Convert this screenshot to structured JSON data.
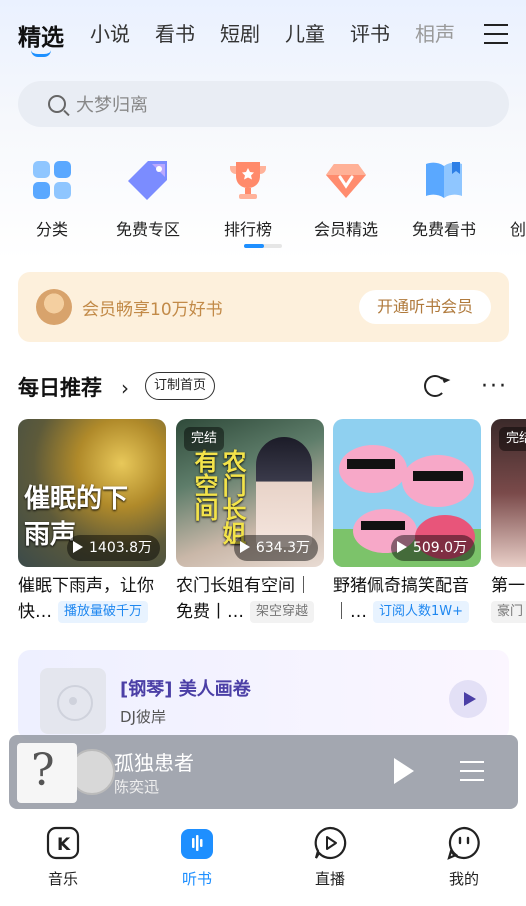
{
  "top_tabs": [
    "精选",
    "小说",
    "看书",
    "短剧",
    "儿童",
    "评书",
    "相声"
  ],
  "search": {
    "placeholder": "大梦归离"
  },
  "categories": [
    {
      "label": "分类",
      "icon": "category-grid-icon"
    },
    {
      "label": "免费专区",
      "icon": "tag-icon"
    },
    {
      "label": "排行榜",
      "icon": "trophy-icon"
    },
    {
      "label": "会员精选",
      "icon": "diamond-icon"
    },
    {
      "label": "免费看书",
      "icon": "book-icon"
    },
    {
      "label": "创",
      "icon": "create-icon"
    }
  ],
  "vip_banner": {
    "text": "会员畅享10万好书",
    "button": "开通听书会员"
  },
  "daily": {
    "title": "每日推荐",
    "arrow": "›",
    "pill": "订制首页",
    "more": "···"
  },
  "cards": [
    {
      "cover_text": "催眠的下雨声",
      "plays": "1403.8万",
      "title": "催眠下雨声，让你",
      "sub": "快…",
      "tag": "播放量破千万",
      "tag_style": "blue",
      "badge": ""
    },
    {
      "cover_text": "农门长姐 有空间",
      "plays": "634.3万",
      "title": "农门长姐有空间｜",
      "sub": "免费丨…",
      "tag": "架空穿越",
      "tag_style": "gray",
      "badge": "完结"
    },
    {
      "cover_text": "",
      "plays": "509.0万",
      "title": "野猪佩奇搞笑配音",
      "sub": "｜…",
      "tag": "订阅人数1W+",
      "tag_style": "blue",
      "badge": ""
    },
    {
      "cover_text": "",
      "plays": "",
      "title": "第一",
      "sub": "",
      "tag": "豪门",
      "tag_style": "gray",
      "badge": "完结"
    }
  ],
  "music_card": {
    "title": "[钢琴] 美人画卷",
    "artist": "DJ彼岸"
  },
  "player": {
    "title": "孤独患者",
    "artist": "陈奕迅"
  },
  "bottom_nav": [
    {
      "label": "音乐",
      "icon": "music-k-icon"
    },
    {
      "label": "听书",
      "icon": "audiobook-icon"
    },
    {
      "label": "直播",
      "icon": "live-play-icon"
    },
    {
      "label": "我的",
      "icon": "profile-smile-icon"
    }
  ],
  "colors": {
    "accent": "#1e8fff",
    "vip_text": "#c28a48",
    "music_title": "#4b3fa6"
  }
}
